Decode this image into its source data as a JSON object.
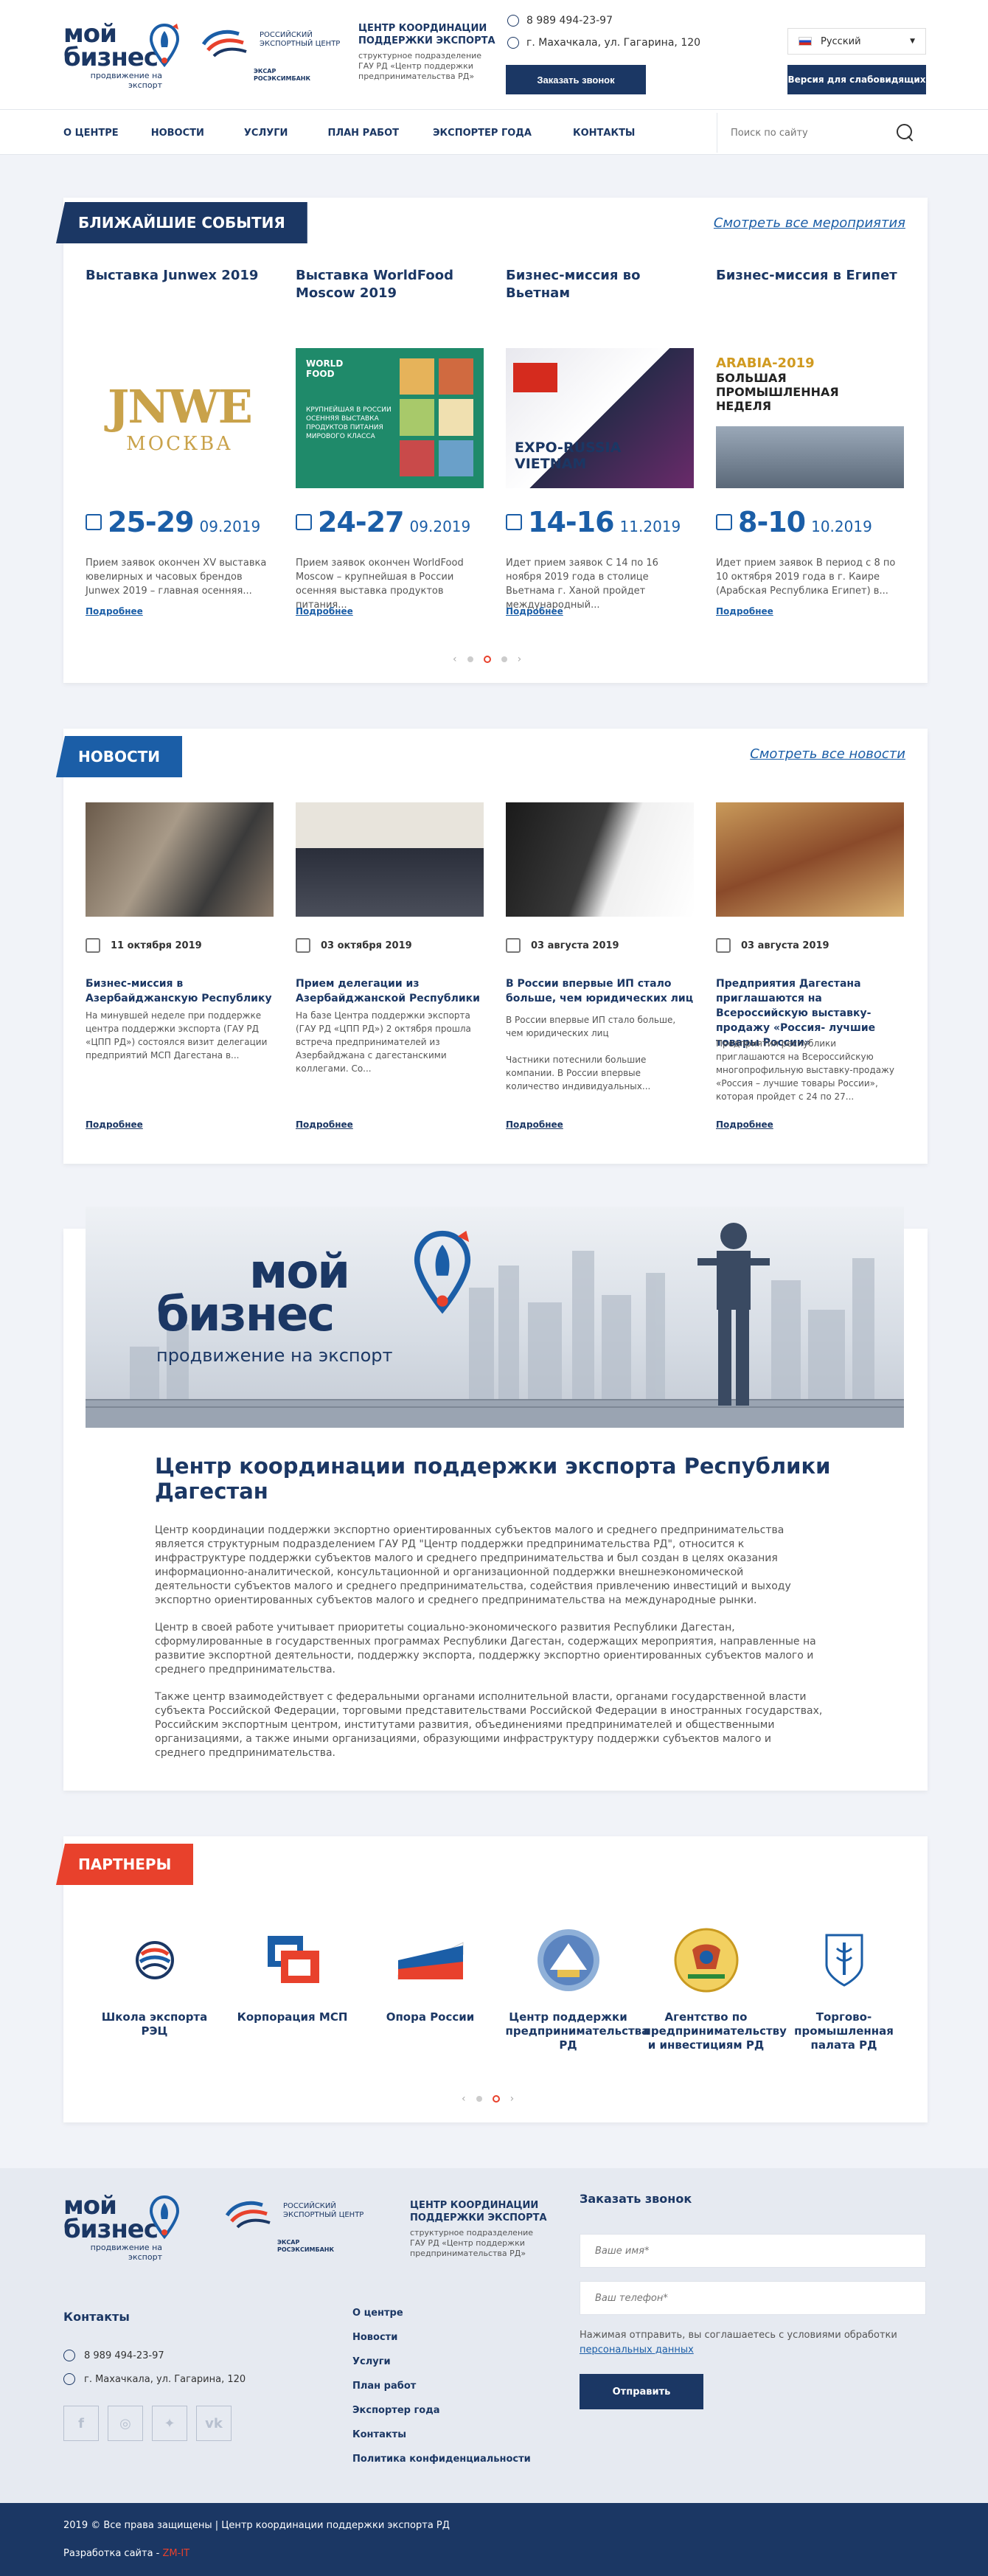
{
  "header": {
    "logo_line1": "мой",
    "logo_line2": "бизнес",
    "logo_sub": "продвижение на экспорт",
    "rec_text": "РОССИЙСКИЙ ЭКСПОРТНЫЙ ЦЕНТР",
    "rec_exar": "ЭКСАР",
    "rec_bank": "РОСЭКСИМБАНК",
    "center_title": "ЦЕНТР КООРДИНАЦИИ ПОДДЕРЖКИ ЭКСПОРТА",
    "center_sub": "структурное подразделение ГАУ РД «Центр поддержки предпринимательства РД»",
    "phone": "8 989 494-23-97",
    "address": "г. Махачкала, ул. Гагарина, 120",
    "call_button": "Заказать звонок",
    "language": "Русский",
    "vision_button": "Версия для слабовидящих"
  },
  "nav": {
    "items": [
      "О центре",
      "Новости",
      "Услуги",
      "План работ",
      "Экспортер года",
      "Контакты"
    ],
    "search_placeholder": "Поиск по сайту"
  },
  "events": {
    "label": "БЛИЖАЙШИЕ СОБЫТИЯ",
    "see_all": "Смотреть все мероприятия",
    "items": [
      {
        "title": "Выставка Junwex 2019",
        "date_days": "25-29",
        "date_month": "09.2019",
        "desc": "Прием заявок окончен XV выставка ювелирных и часовых брендов Junwex 2019 – главная осенняя...",
        "more": "Подробнее",
        "img_text1": "JNWE",
        "img_text2": "МОСКВА"
      },
      {
        "title": "Выставка WorldFood Moscow 2019",
        "date_days": "24-27",
        "date_month": "09.2019",
        "desc": "Прием заявок окончен WorldFood Moscow – крупнейшая в России осенняя выставка продуктов питания...",
        "more": "Подробнее",
        "img_text1": "WORLD FOOD",
        "img_text2": "КРУПНЕЙШАЯ В РОССИИ ОСЕННЯЯ ВЫСТАВКА ПРОДУКТОВ ПИТАНИЯ МИРОВОГО КЛАССА"
      },
      {
        "title": "Бизнес-миссия во Вьетнам",
        "date_days": "14-16",
        "date_month": "11.2019",
        "desc": "Идет прием заявок С 14 по 16 ноября 2019 года в столице Вьетнама г. Ханой пройдет международный...",
        "more": "Подробнее",
        "img_text1": "EXPO-RUSSIA",
        "img_text2": "VIETNAM"
      },
      {
        "title": "Бизнес-миссия в Египет",
        "date_days": "8-10",
        "date_month": "10.2019",
        "desc": "Идет прием заявок В период с 8 по 10 октября 2019 года в г. Каире (Арабская Республика Египет) в...",
        "more": "Подробнее",
        "img_text1": "ARABIA-2019",
        "img_text2": "БОЛЬШАЯ ПРОМЫШЛЕННАЯ НЕДЕЛЯ"
      }
    ]
  },
  "news": {
    "label": "НОВОСТИ",
    "see_all": "Смотреть все новости",
    "items": [
      {
        "date": "11 октября 2019",
        "title": "Бизнес-миссия в Азербайджанскую Республику",
        "desc": "На минувшей неделе при поддержке центра поддержки экспорта (ГАУ РД «ЦПП РД») состоялся визит делегации предприятий МСП Дагестана в...",
        "more": "Подробнее"
      },
      {
        "date": "03 октября 2019",
        "title": "Прием делегации из Азербайджанской Республики",
        "desc": "На базе Центра поддержки экспорта (ГАУ РД «ЦПП РД») 2 октября прошла встреча предпринимателей из Азербайджана с дагестанскими коллегами. Со...",
        "more": "Подробнее"
      },
      {
        "date": "03 августа 2019",
        "title": "В России впервые ИП стало больше, чем юридических лиц",
        "desc": "В России впервые ИП стало больше, чем юридических лиц\n\nЧастники потеснили большие компании. В России впервые количество индивидуальных...",
        "more": "Подробнее"
      },
      {
        "date": "03 августа 2019",
        "title": "Предприятия Дагестана приглашаются на Всероссийскую выставку-продажу «Россия- лучшие товары России»",
        "desc": "Предприятия республики приглашаются на Всероссийскую многопрофильную выставку-продажу «Россия – лучшие товары России», которая пройдет с 24 по 27...",
        "more": "Подробнее"
      }
    ]
  },
  "about": {
    "banner_line1": "мой",
    "banner_line2": "бизнес",
    "banner_sub": "продвижение на экспорт",
    "title": "Центр координации поддержки экспорта Республики Дагестан",
    "paragraphs": [
      "Центр координации поддержки экспортно ориентированных субъектов малого и среднего предпринимательства является структурным подразделением ГАУ РД \"Центр поддержки предпринимательства РД\", относится к инфраструктуре поддержки субъектов малого и среднего предпринимательства и был создан в целях оказания информационно-аналитической, консультационной и организационной поддержки внешнеэкономической деятельности субъектов малого и среднего предпринимательства, содействия привлечению инвестиций и выходу экспортно ориентированных субъектов малого и среднего предпринимательства на международные рынки.",
      "Центр в своей работе учитывает приоритеты социально-экономического развития Республики Дагестан, сформулированные в государственных программах Республики Дагестан, содержащих мероприятия, направленные на развитие экспортной деятельности, поддержку экспорта, поддержку экспортно ориентированных субъектов малого и среднего предпринимательства.",
      "Также центр взаимодействует с федеральными органами исполнительной власти, органами государственной власти субъекта Российской Федерации, торговыми представительствами Российской Федерации в иностранных государствах, Российским экспортным центром, институтами развития, объединениями предпринимателей и общественными организациями, а также иными организациями, образующими инфраструктуру поддержки субъектов малого и среднего предпринимательства."
    ]
  },
  "partners": {
    "label": "ПАРТНЕРЫ",
    "items": [
      {
        "name": "Школа экспорта РЭЦ"
      },
      {
        "name": "Корпорация МСП"
      },
      {
        "name": "Опора России"
      },
      {
        "name": "Центр поддержки предпринимательства РД"
      },
      {
        "name": "Агентство по предпринимательству и инвестициям РД"
      },
      {
        "name": "Торгово-промышленная палата РД"
      }
    ]
  },
  "footer": {
    "contacts_title": "Контакты",
    "phone": "8 989 494-23-97",
    "address": "г. Махачкала, ул. Гагарина, 120",
    "menu": [
      "О центре",
      "Новости",
      "Услуги",
      "План работ",
      "Экспортер года",
      "Контакты",
      "Политика конфиденциальности"
    ],
    "form_title": "Заказать звонок",
    "name_placeholder": "Ваше имя*",
    "phone_placeholder": "Ваш телефон*",
    "note": "Нажимая отправить, вы соглашаетесь с условиями обработки",
    "note_link": "персональных данных",
    "submit": "Отправить",
    "copyright": "2019 © Все права защищены | Центр координации поддержки экспорта РД",
    "dev_label": "Разработка сайта - ",
    "dev_name": "ZM-IT"
  },
  "colors": {
    "brand_dark": "#1b3764",
    "brand_blue": "#1b5ea7",
    "accent_red": "#e8412c"
  }
}
